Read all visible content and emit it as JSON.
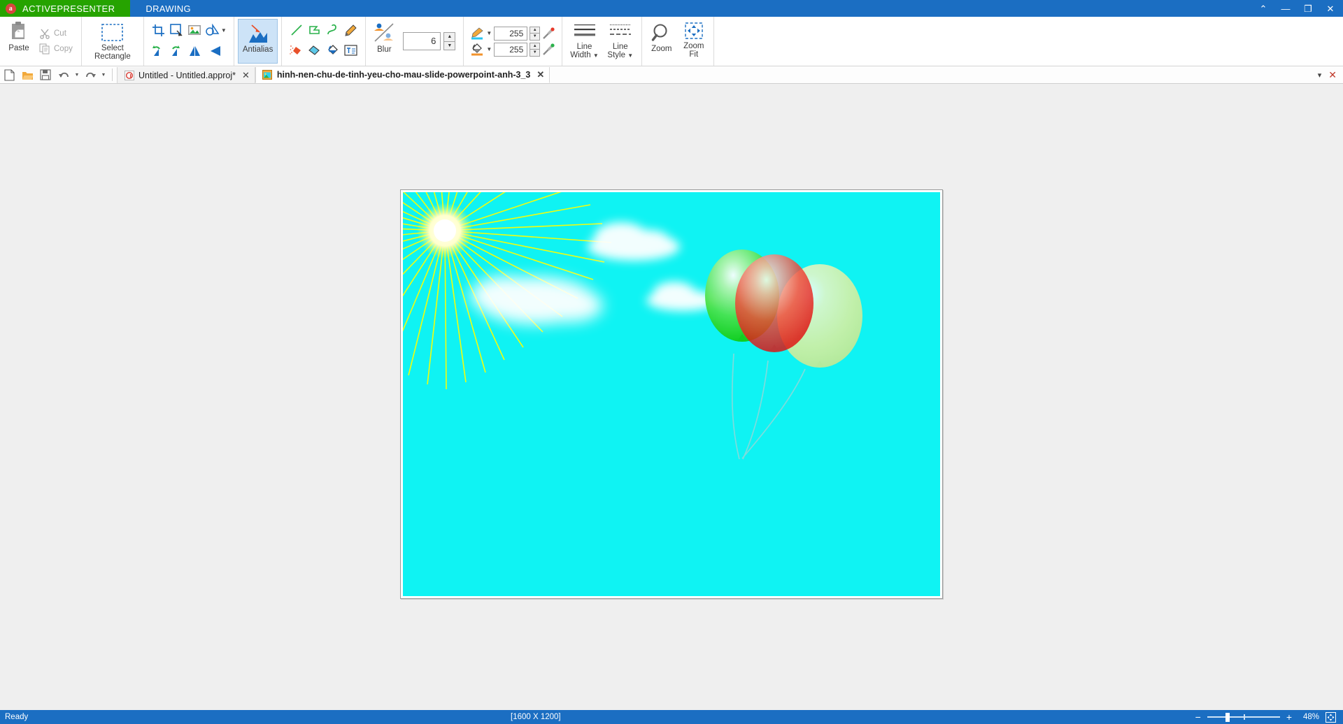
{
  "titlebar": {
    "app_tab": "ACTIVEPRESENTER",
    "app_logo_glyph": "a",
    "ribbon_tab": "DRAWING",
    "window_controls": [
      {
        "name": "collapse-ribbon-icon",
        "glyph": "⌃"
      },
      {
        "name": "minimize-icon",
        "glyph": "—"
      },
      {
        "name": "restore-icon",
        "glyph": "❐"
      },
      {
        "name": "close-icon",
        "glyph": "✕"
      }
    ]
  },
  "ribbon": {
    "clipboard": {
      "paste_label": "Paste",
      "cut_label": "Cut",
      "copy_label": "Copy"
    },
    "selection": {
      "select_rectangle_label": "Select\nRectangle",
      "select_line1": "Select",
      "select_line2": "Rectangle"
    },
    "image_tools": {
      "row1": [
        "crop-icon",
        "resize-icon",
        "image-icon",
        "shape-select-icon"
      ],
      "row2": [
        "rotate-left-icon",
        "rotate-right-icon",
        "flip-horizontal-icon",
        "flip-vertical-icon"
      ]
    },
    "antialias": {
      "label": "Antialias",
      "selected": true
    },
    "draw_tools": {
      "row1": [
        "line-icon",
        "polygon-icon",
        "curve-icon",
        "pencil-icon"
      ],
      "row2": [
        "spray-icon",
        "eraser-icon",
        "fill-bucket-icon",
        "text-icon"
      ]
    },
    "blur": {
      "label": "Blur",
      "value": "6"
    },
    "colors": {
      "foreground_value": "255",
      "background_value": "255",
      "foreground_icon": "pen-color-icon",
      "background_icon": "fill-color-icon",
      "picker_fg_icon": "eyedropper-red-icon",
      "picker_bg_icon": "eyedropper-green-icon"
    },
    "line_width": {
      "line1": "Line",
      "line2": "Width"
    },
    "line_style": {
      "line1": "Line",
      "line2": "Style"
    },
    "zoom_button": {
      "label": "Zoom"
    },
    "zoom_fit_button": {
      "line1": "Zoom",
      "line2": "Fit"
    }
  },
  "quickbar": {
    "buttons": [
      {
        "name": "new-file-button",
        "icon": "new-file-icon"
      },
      {
        "name": "open-file-button",
        "icon": "open-folder-icon"
      },
      {
        "name": "save-file-button",
        "icon": "save-disk-icon"
      },
      {
        "name": "undo-button",
        "icon": "undo-icon"
      },
      {
        "name": "redo-button",
        "icon": "redo-icon"
      }
    ],
    "tabs": [
      {
        "title": "Untitled - Untitled.approj*",
        "active": false,
        "icon": "activepresenter-doc-icon"
      },
      {
        "title": "hinh-nen-chu-de-tinh-yeu-cho-mau-slide-powerpoint-anh-3_3",
        "active": true,
        "icon": "image-doc-icon"
      }
    ],
    "close_glyph": "✕",
    "right_controls": [
      {
        "name": "tabs-dropdown-icon",
        "glyph": "▾"
      },
      {
        "name": "close-all-tabs-icon",
        "glyph": "✕"
      }
    ]
  },
  "canvas": {
    "background_color": "#0ff3f3",
    "sun_color": "#ffff00",
    "cloud_color": "#ffffff",
    "balloons": [
      {
        "name": "green-balloon",
        "color": "#19e519"
      },
      {
        "name": "red-balloon",
        "color": "#f01818"
      },
      {
        "name": "yellow-balloon",
        "color": "#f2f29a"
      }
    ]
  },
  "statusbar": {
    "ready_text": "Ready",
    "dimensions": "[1600 X 1200]",
    "zoom_minus": "−",
    "zoom_plus": "+",
    "zoom_percent": "48%",
    "fit_icon": "fit-to-window-icon"
  }
}
